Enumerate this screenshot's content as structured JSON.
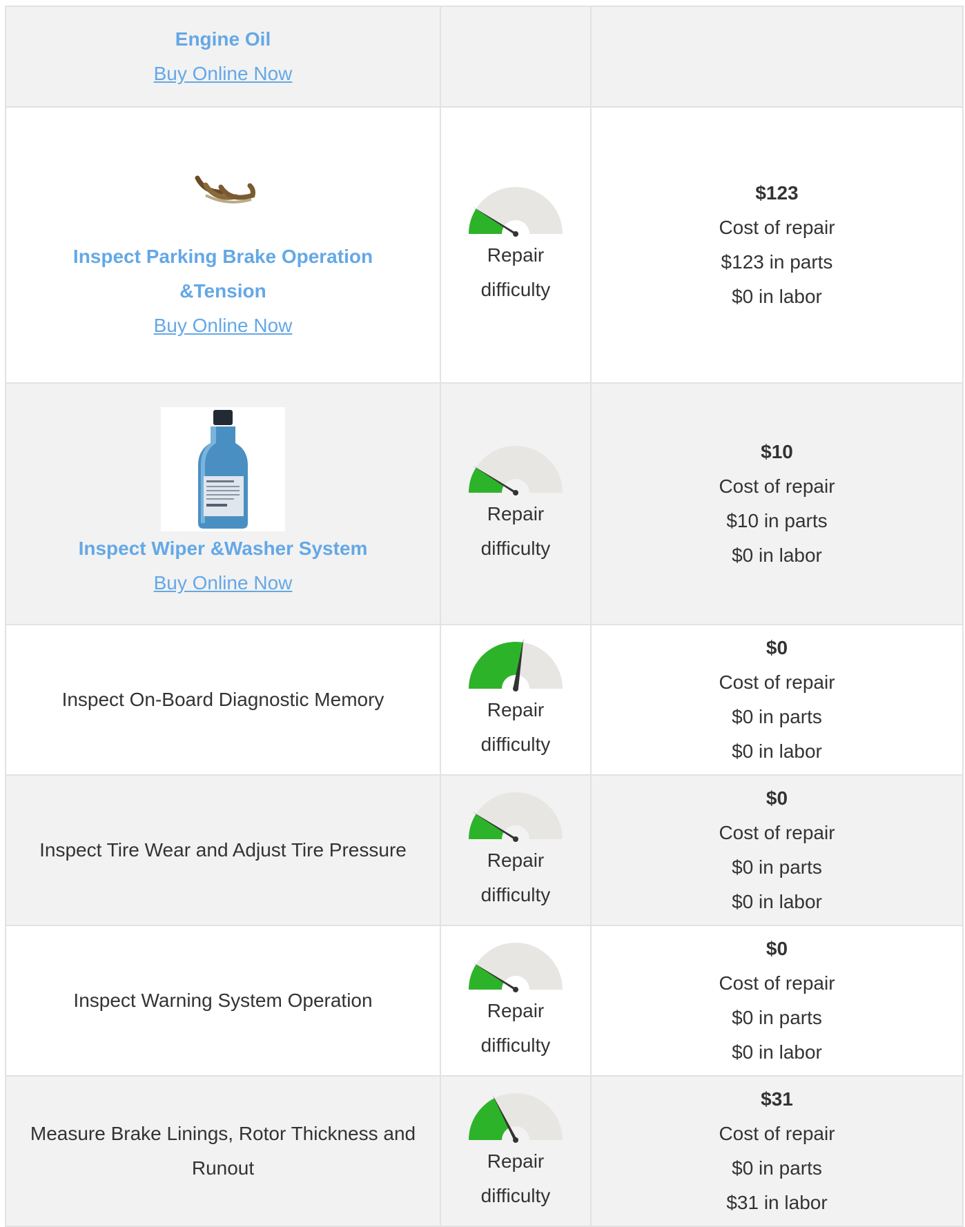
{
  "buy_label": "Buy Online Now",
  "difficulty_label_1": "Repair",
  "difficulty_label_2": "difficulty",
  "cost_label": "Cost of repair",
  "colors": {
    "link": "#64a8e6",
    "gauge_green": "#2db32a",
    "gauge_track": "#e8e6e2",
    "needle": "#333333"
  },
  "rows": [
    {
      "service": "Engine Oil"
    },
    {
      "service": "Inspect Parking Brake Operation &Tension",
      "image": "brake-shoes-icon",
      "difficulty": 0.18,
      "price": "$123",
      "parts": "$123 in parts",
      "labor": "$0 in labor"
    },
    {
      "service": "Inspect Wiper &Washer System",
      "image": "washer-fluid-bottle-icon",
      "difficulty": 0.18,
      "price": "$10",
      "parts": "$10 in parts",
      "labor": "$0 in labor"
    },
    {
      "service": "Inspect On-Board Diagnostic Memory",
      "difficulty": 0.55,
      "price": "$0",
      "parts": "$0 in parts",
      "labor": "$0 in labor"
    },
    {
      "service": "Inspect Tire Wear and Adjust Tire Pressure",
      "difficulty": 0.18,
      "price": "$0",
      "parts": "$0 in parts",
      "labor": "$0 in labor"
    },
    {
      "service": "Inspect Warning System Operation",
      "difficulty": 0.18,
      "price": "$0",
      "parts": "$0 in parts",
      "labor": "$0 in labor"
    },
    {
      "service": "Measure Brake Linings, Rotor Thickness and Runout",
      "difficulty": 0.35,
      "price": "$31",
      "parts": "$0 in parts",
      "labor": "$31 in labor"
    }
  ]
}
